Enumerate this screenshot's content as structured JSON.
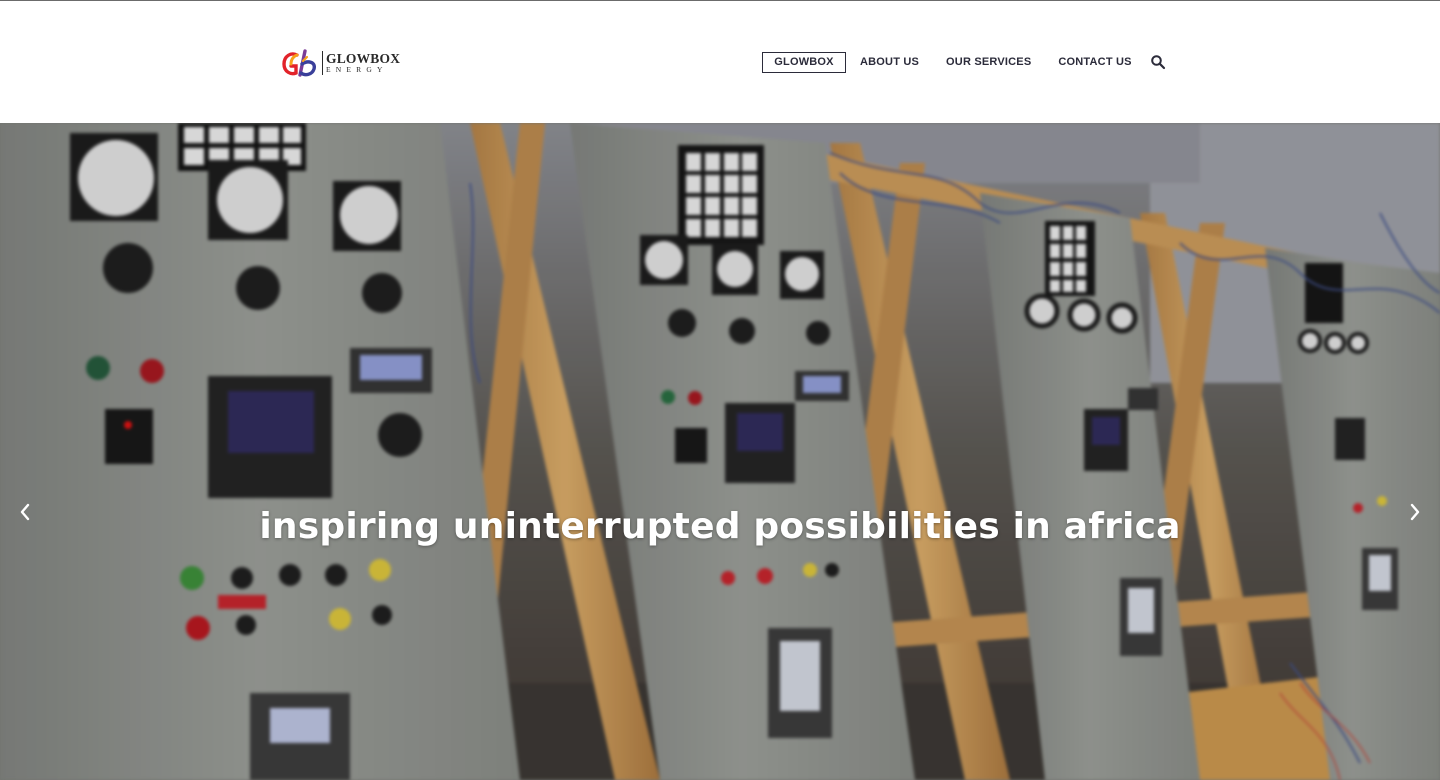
{
  "brand": {
    "name_line1": "GLOWBOX",
    "name_line2": "ENERGY",
    "mark_text": "Gb",
    "colors": [
      "#e2232a",
      "#f7a21b",
      "#3a3f9a",
      "#7a3c96"
    ]
  },
  "nav": {
    "items": [
      {
        "label": "GLOWBOX",
        "active": true
      },
      {
        "label": "ABOUT US",
        "active": false
      },
      {
        "label": "OUR SERVICES",
        "active": false
      },
      {
        "label": "CONTACT US",
        "active": false
      }
    ],
    "search_icon": "search-icon"
  },
  "hero": {
    "caption": "inspiring uninterrupted possibilities in africa",
    "prev_icon": "chevron-left-icon",
    "next_icon": "chevron-right-icon"
  },
  "colors": {
    "nav_text": "#2b2b3a",
    "panel_gray": "#8e918b",
    "wood": "#c99a5a",
    "caption": "#ffffff"
  }
}
